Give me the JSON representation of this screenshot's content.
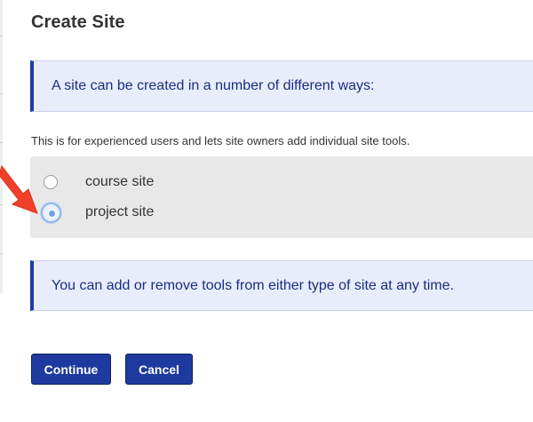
{
  "page": {
    "title": "Create Site"
  },
  "info_top": {
    "text": "A site can be created in a number of different ways:"
  },
  "description": "This is for experienced users and lets site owners add individual site tools.",
  "site_type_options": [
    {
      "label": "course site",
      "selected": false
    },
    {
      "label": "project site",
      "selected": true
    }
  ],
  "info_bottom": {
    "text": "You can add or remove tools from either type of site at any time."
  },
  "buttons": {
    "continue_label": "Continue",
    "cancel_label": "Cancel"
  },
  "colors": {
    "primary_button": "#1e3a9e",
    "info_background": "#e8edfc",
    "info_accent": "#1f3aa3",
    "annotation_arrow": "#f0402a"
  },
  "icons": {
    "annotation": "red-arrow-icon"
  }
}
